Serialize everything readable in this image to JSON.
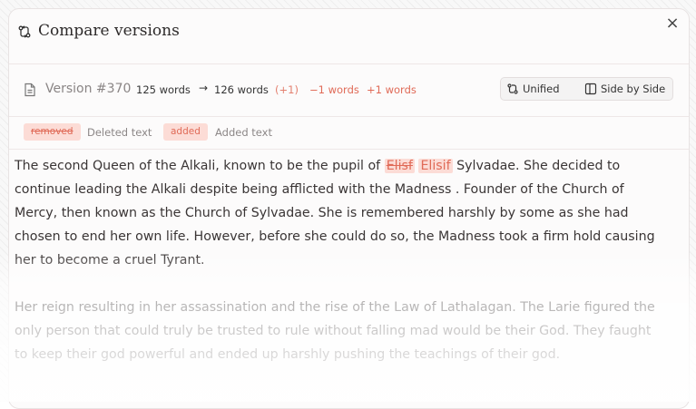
{
  "modal": {
    "title": "Compare versions",
    "close_label": "×"
  },
  "meta": {
    "version": "Version #370",
    "words_from": "125 words",
    "arrow": "→",
    "words_to": "126 words",
    "delta": "(+1)",
    "removed_count": "−1 words",
    "added_count": "+1 words"
  },
  "view_toggle": {
    "unified_label": "Unified",
    "side_by_side_label": "Side by Side"
  },
  "legend": {
    "removed_chip": "removed",
    "removed_desc": "Deleted text",
    "added_chip": "added",
    "added_desc": "Added text"
  },
  "content": {
    "p1_before": "The second Queen of the Alkali, known to be the pupil of ",
    "p1_deleted": "Elisf",
    "p1_inserted": "Elisif",
    "p1_after": " Sylvadae. She decided to continue leading the Alkali despite being afflicted with the Madness . Founder of the Church of Mercy, then known as the Church of Sylvadae. She is  remembered harshly by some as she had chosen to end her own life. However, before she could do so, the Madness took a firm hold causing her to become a cruel Tyrant.",
    "p2": "Her reign resulting in her assassination and the rise of the Law of Lathalagan. The Larie figured the only person that could truly be trusted to rule without falling mad would be their God. They faught to keep their god powerful and ended up harshly pushing the teachings of their god."
  }
}
